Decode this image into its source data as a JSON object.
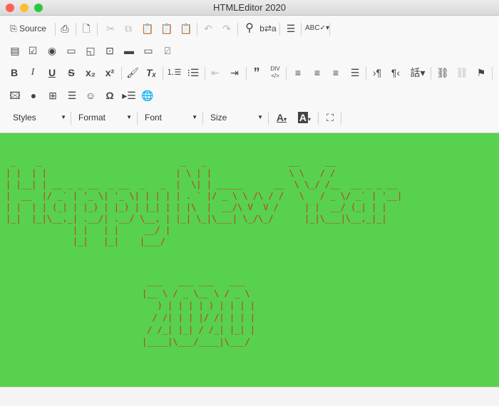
{
  "window": {
    "title": "HTMLEditor 2020",
    "controls": {
      "close": "#fe5f57",
      "minimize": "#febc2e",
      "zoom": "#28c840"
    }
  },
  "toolbar": {
    "source_label": "Source",
    "styles_label": "Styles",
    "format_label": "Format",
    "font_label": "Font",
    "size_label": "Size"
  },
  "content": {
    "background": "#57d14e",
    "text_color": "#c23a1e",
    "heading_lines": [
      " _    _                           _   _                __     __",
      "| |  | |                         | \\ | |               \\ \\   / /",
      "| |__| | __ _ _ __  _ __  _   _  |  \\| | _____      __  \\ \\_/ /__  __ _ _ __",
      "|  __  |/ _` | '_ \\| '_ \\| | | | | . ` |/ _ \\ \\ /\\ / /   \\   / _ \\/ _` | '__|",
      "| |  | | (_| | |_) | |_) | |_| | | |\\  |  __/\\ V  V /     | |  __/ (_| | |",
      "|_|  |_|\\__,_| .__/| .__/ \\__, | |_| \\_|\\___| \\_/\\_/      |_|\\___|\\__,_|_|",
      "             | |   | |     __/ |",
      "             |_|   |_|    |___/"
    ],
    "year_lines": [
      " ___   ___ ___   ___",
      "|__ \\ / _ \\__ \\ / _ \\",
      "   ) | | | | ) | | | |",
      "  / /| | | |/ /| | | |",
      " / /_| |_| / /_| |_| |",
      "|____|\\___/____|\\___/"
    ]
  }
}
